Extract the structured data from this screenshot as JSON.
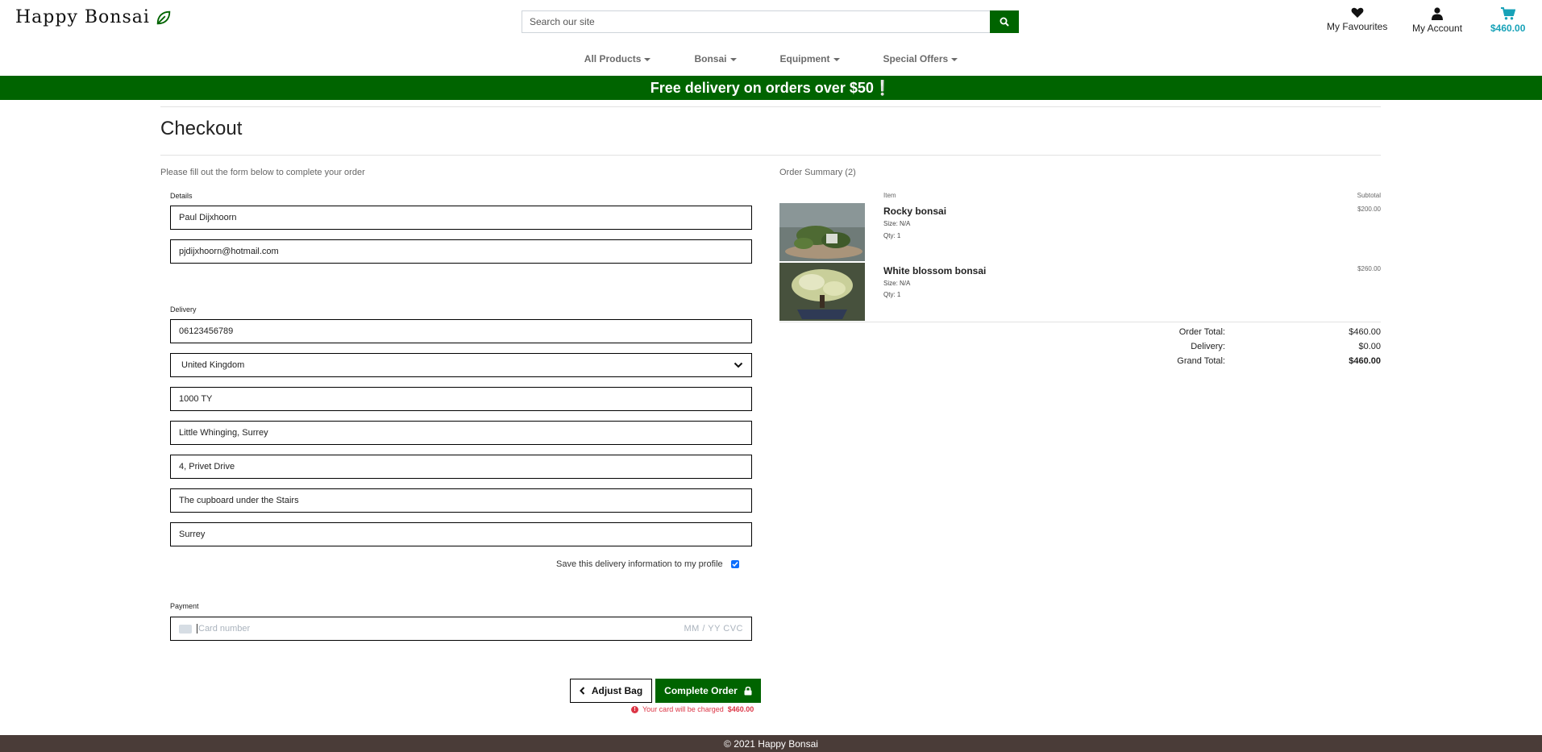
{
  "header": {
    "logo_text": "Happy Bonsai",
    "search_placeholder": "Search our site",
    "favourites_label": "My Favourites",
    "account_label": "My Account",
    "bag_total": "$460.00"
  },
  "nav": {
    "items": [
      {
        "label": "All Products"
      },
      {
        "label": "Bonsai"
      },
      {
        "label": "Equipment"
      },
      {
        "label": "Special Offers"
      }
    ]
  },
  "banner": {
    "text": "Free delivery on orders over $50❕"
  },
  "checkout": {
    "title": "Checkout",
    "subtitle": "Please fill out the form below to complete your order",
    "details_label": "Details",
    "full_name": "Paul Dijxhoorn",
    "email": "pjdijxhoorn@hotmail.com",
    "delivery_label": "Delivery",
    "phone": "06123456789",
    "country": "United Kingdom",
    "postcode": "1000 TY",
    "town": "Little Whinging, Surrey",
    "street1": "4, Privet Drive",
    "street2": "The cupboard under the Stairs",
    "county": "Surrey",
    "save_info_label": "Save this delivery information to my profile",
    "save_info_checked": true,
    "payment_label": "Payment",
    "card_placeholder": "Card number",
    "card_expiry_cvc": "MM / YY  CVC",
    "adjust_bag_label": "Adjust Bag",
    "complete_order_label": "Complete Order",
    "charge_notice": "Your card will be charged",
    "charge_amount": "$460.00"
  },
  "summary": {
    "title": "Order Summary (2)",
    "item_header": "Item",
    "subtotal_header": "Subtotal",
    "items": [
      {
        "name": "Rocky bonsai",
        "size": "Size: N/A",
        "qty": "Qty: 1",
        "price": "$200.00"
      },
      {
        "name": "White blossom bonsai",
        "size": "Size: N/A",
        "qty": "Qty: 1",
        "price": "$260.00"
      }
    ],
    "order_total_label": "Order Total:",
    "order_total": "$460.00",
    "delivery_label": "Delivery:",
    "delivery": "$0.00",
    "grand_total_label": "Grand Total:",
    "grand_total": "$460.00"
  },
  "footer": {
    "text": "© 2021 Happy Bonsai"
  },
  "colors": {
    "brand_green": "#006400",
    "bag_accent": "#17a2b8",
    "error_red": "#dc3545",
    "footer_brown": "#4a3c38"
  }
}
